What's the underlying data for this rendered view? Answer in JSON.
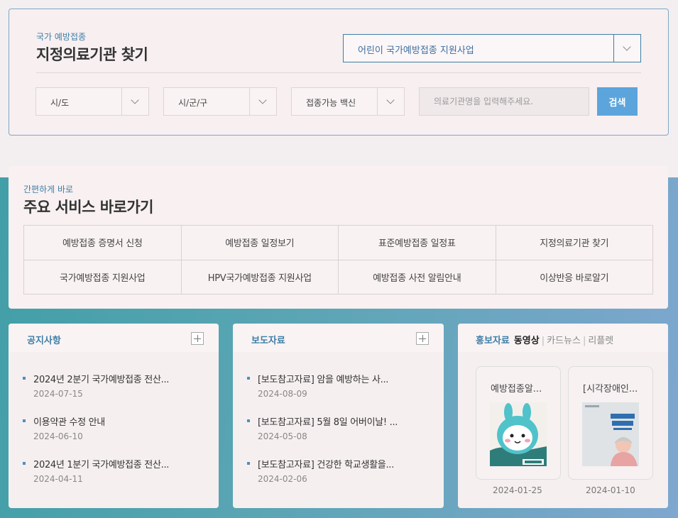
{
  "finder": {
    "subtitle": "국가 예방접종",
    "title": "지정의료기관 찾기",
    "program_value": "어린이 국가예방접종 지원사업",
    "sido": "시/도",
    "sigungu": "시/군/구",
    "vaccine": "접종가능 백신",
    "search_placeholder": "의료기관명을 입력해주세요.",
    "search_button": "검색"
  },
  "quick": {
    "subtitle": "간편하게 바로",
    "title": "주요 서비스 바로가기",
    "items": [
      "예방접종 증명서 신청",
      "예방접종 일정보기",
      "표준예방접종 일정표",
      "지정의료기관 찾기",
      "국가예방접종 지원사업",
      "HPV국가예방접종 지원사업",
      "예방접종 사전 알림안내",
      "이상반응 바로알기"
    ]
  },
  "notice": {
    "title": "공지사항",
    "items": [
      {
        "title": "2024년 2분기 국가예방접종 전산...",
        "date": "2024-07-15"
      },
      {
        "title": "이용약관 수정 안내",
        "date": "2024-06-10"
      },
      {
        "title": "2024년 1분기 국가예방접종 전산...",
        "date": "2024-04-11"
      }
    ]
  },
  "press": {
    "title": "보도자료",
    "items": [
      {
        "title": "[보도참고자료] 암을 예방하는 사...",
        "date": "2024-08-09"
      },
      {
        "title": "[보도참고자료] 5월 8일 어버이날! ...",
        "date": "2024-05-08"
      },
      {
        "title": "[보도참고자료] 건강한 학교생활을...",
        "date": "2024-02-06"
      }
    ]
  },
  "promo": {
    "label": "홍보자료",
    "tabs": [
      "동영상",
      "카드뉴스",
      "리플렛"
    ],
    "cards": [
      {
        "title": "예방접종알...",
        "date": "2024-01-25",
        "icon": "rabbit-mascot-thumbnail"
      },
      {
        "title": "[시각장애인...",
        "date": "2024-01-10",
        "icon": "leaflet-cover-thumbnail"
      }
    ]
  },
  "colors": {
    "accent": "#3f7fa6",
    "button": "#5ba5dc",
    "background_teal": "#4fa0ab"
  }
}
